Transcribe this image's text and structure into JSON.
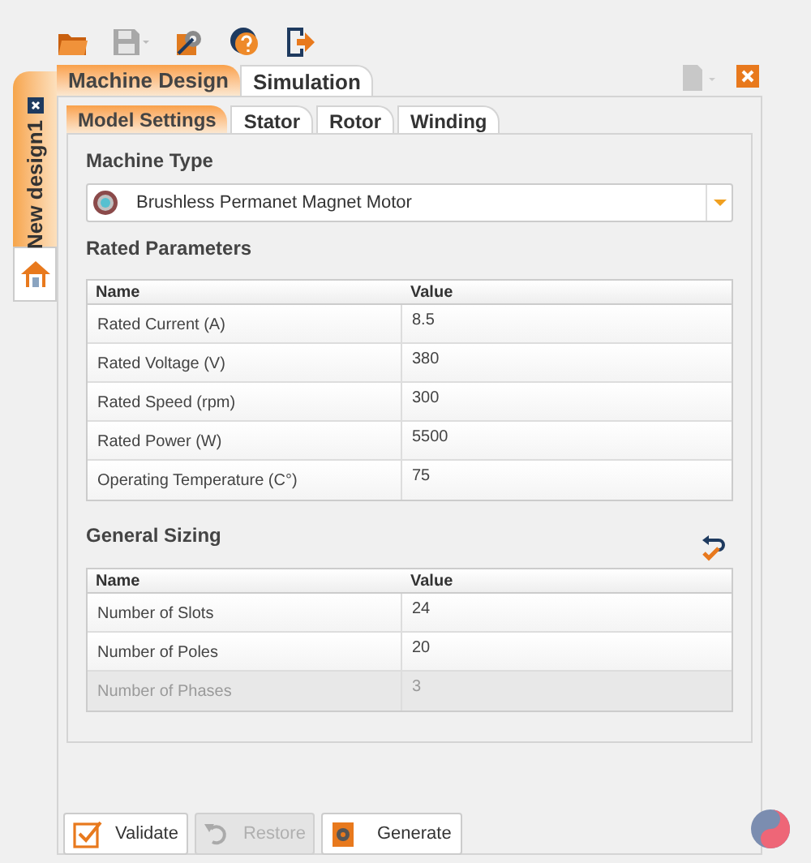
{
  "document_tabs": [
    {
      "label": "New design1",
      "selected": true
    }
  ],
  "main_tabs": [
    {
      "label": "Machine Design",
      "selected": true
    },
    {
      "label": "Simulation",
      "selected": false
    }
  ],
  "sub_tabs": [
    {
      "label": "Model Settings",
      "selected": true
    },
    {
      "label": "Stator",
      "selected": false
    },
    {
      "label": "Rotor",
      "selected": false
    },
    {
      "label": "Winding",
      "selected": false
    }
  ],
  "machine_type": {
    "title": "Machine Type",
    "value": "Brushless Permanet Magnet Motor"
  },
  "rated_parameters": {
    "title": "Rated Parameters",
    "columns": [
      "Name",
      "Value"
    ],
    "rows": [
      {
        "name": "Rated Current (A)",
        "value": "8.5",
        "disabled": false
      },
      {
        "name": "Rated Voltage (V)",
        "value": "380",
        "disabled": false
      },
      {
        "name": "Rated Speed (rpm)",
        "value": "300",
        "disabled": false
      },
      {
        "name": "Rated Power (W)",
        "value": "5500",
        "disabled": false
      },
      {
        "name": "Operating Temperature (C°)",
        "value": "75",
        "disabled": false
      }
    ]
  },
  "general_sizing": {
    "title": "General Sizing",
    "columns": [
      "Name",
      "Value"
    ],
    "rows": [
      {
        "name": "Number of Slots",
        "value": "24",
        "disabled": false
      },
      {
        "name": "Number of Poles",
        "value": "20",
        "disabled": false
      },
      {
        "name": "Number of Phases",
        "value": "3",
        "disabled": true
      }
    ]
  },
  "buttons": [
    {
      "kind": "validate",
      "label": "Validate",
      "disabled": false
    },
    {
      "kind": "restore",
      "label": "Restore",
      "disabled": true
    },
    {
      "kind": "generate",
      "label": "Generate",
      "disabled": false
    }
  ]
}
